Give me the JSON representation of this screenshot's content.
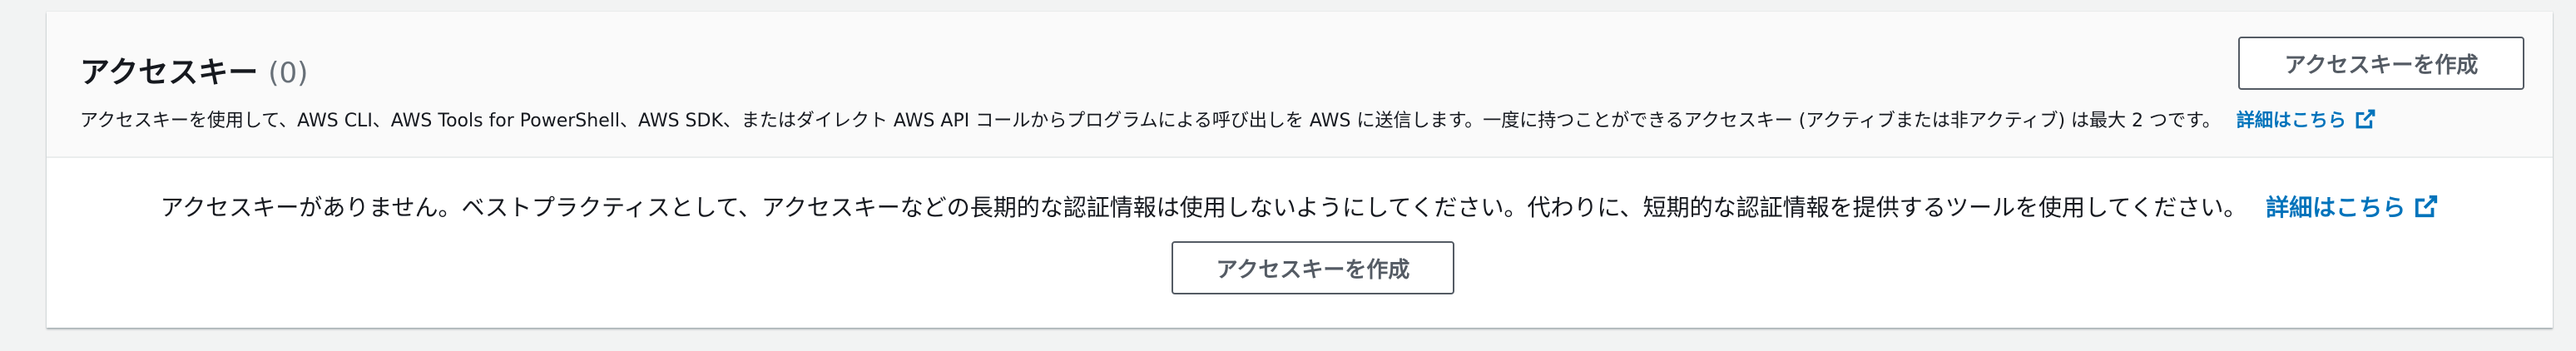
{
  "header": {
    "title": "アクセスキー",
    "count": "(0)",
    "description": "アクセスキーを使用して、AWS CLI、AWS Tools for PowerShell、AWS SDK、またはダイレクト AWS API コールからプログラムによる呼び出しを AWS に送信します。一度に持つことができるアクセスキー (アクティブまたは非アクティブ) は最大 2 つです。",
    "learn_more_link": "詳細はこちら",
    "create_button_label": "アクセスキーを作成"
  },
  "empty_state": {
    "message": "アクセスキーがありません。ベストプラクティスとして、アクセスキーなどの長期的な認証情報は使用しないようにしてください。代わりに、短期的な認証情報を提供するツールを使用してください。",
    "learn_more_link": "詳細はこちら",
    "create_button_label": "アクセスキーを作成"
  },
  "colors": {
    "link": "#0073bb",
    "button_border": "#545b64",
    "muted": "#687078"
  },
  "icons": {
    "external_link": "external-link-icon"
  }
}
